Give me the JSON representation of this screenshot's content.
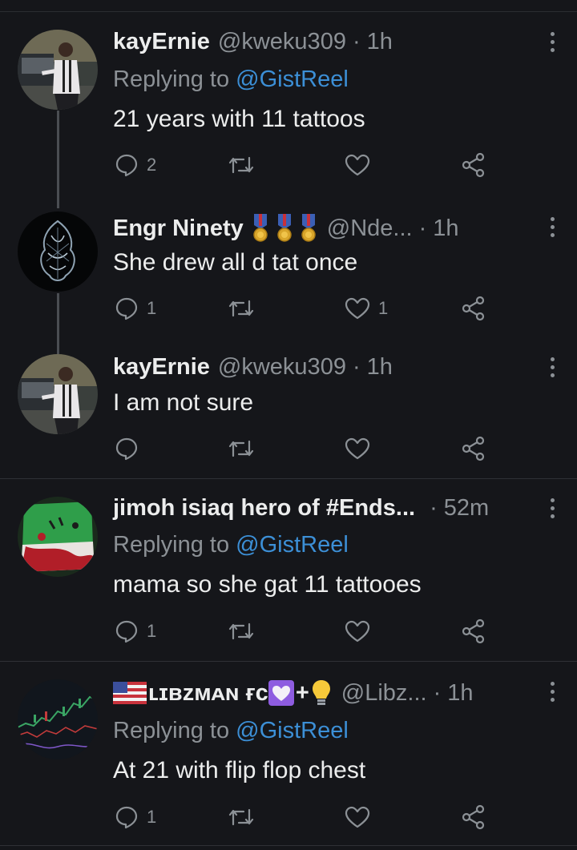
{
  "tweets": [
    {
      "name": "kayErnie",
      "handle": "@kweku309",
      "time": "· 1h",
      "replying_prefix": "Replying to",
      "replying_to": "@GistReel",
      "text": "21 years with 11 tattoos",
      "reply_count": "2",
      "retweet_count": "",
      "like_count": ""
    },
    {
      "name": "Engr Ninety",
      "badges": [
        "military-medal-icon",
        "military-medal-icon",
        "military-medal-icon"
      ],
      "handle": "@Nde...",
      "time": "· 1h",
      "text": "She drew all d  tat once",
      "reply_count": "1",
      "retweet_count": "",
      "like_count": "1"
    },
    {
      "name": "kayErnie",
      "handle": "@kweku309",
      "time": "· 1h",
      "text": "I am not sure",
      "reply_count": "",
      "retweet_count": "",
      "like_count": ""
    },
    {
      "name": "jimoh isiaq hero of #Ends...",
      "handle": "",
      "time": "· 52m",
      "replying_prefix": "Replying to",
      "replying_to": "@GistReel",
      "text": "mama so she gat 11 tattooes",
      "reply_count": "1",
      "retweet_count": "",
      "like_count": ""
    },
    {
      "name": "ʟɪʙᴢᴍᴀɴ ғᴄ",
      "name_flag": "us-flag-icon",
      "name_emojis": [
        "white-heart-icon",
        "plus-sign",
        "light-bulb-icon"
      ],
      "plus": "+",
      "handle": "@Libz...",
      "time": "· 1h",
      "replying_prefix": "Replying to",
      "replying_to": "@GistReel",
      "text": "At 21 with flip flop chest",
      "reply_count": "1",
      "retweet_count": "",
      "like_count": ""
    }
  ],
  "colors": {
    "background": "#15161a",
    "text": "#eceded",
    "muted": "#8c9196",
    "link": "#3c8fd6",
    "thread_line": "#4a4d52"
  }
}
